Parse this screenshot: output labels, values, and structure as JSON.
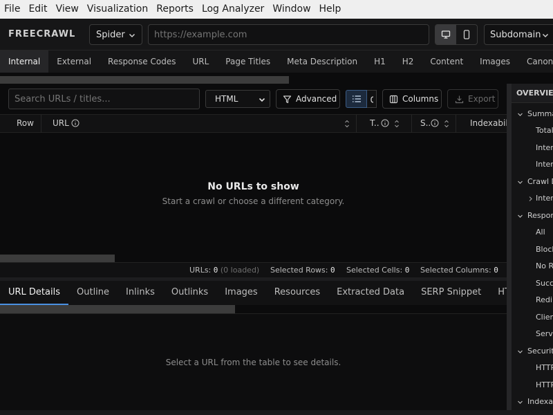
{
  "menu": [
    "File",
    "Edit",
    "View",
    "Visualization",
    "Reports",
    "Log Analyzer",
    "Window",
    "Help"
  ],
  "toolbar": {
    "brand": "FREECRAWL",
    "mode": "Spider",
    "url_placeholder": "https://example.com",
    "device_options": [
      "desktop",
      "mobile"
    ],
    "device_selected": "desktop",
    "scope": "Subdomain"
  },
  "category_tabs": [
    "Internal",
    "External",
    "Response Codes",
    "URL",
    "Page Titles",
    "Meta Description",
    "H1",
    "H2",
    "Content",
    "Images",
    "Canonicals"
  ],
  "category_active": "Internal",
  "filters": {
    "search_placeholder": "Search URLs / titles...",
    "type_select": "HTML",
    "advanced_label": "Advanced",
    "columns_label": "Columns",
    "export_label": "Export"
  },
  "table": {
    "columns": {
      "row": "Row",
      "url": "URL",
      "title": "T..",
      "status": "S..",
      "indexability": "Indexabili"
    },
    "empty_title": "No URLs to show",
    "empty_subtitle": "Start a crawl or choose a different category."
  },
  "status": {
    "urls_label": "URLs:",
    "urls_value": "0",
    "urls_loaded": "(0 loaded)",
    "rows_label": "Selected Rows:",
    "rows_value": "0",
    "cells_label": "Selected Cells:",
    "cells_value": "0",
    "cols_label": "Selected Columns:",
    "cols_value": "0"
  },
  "detail_tabs": [
    "URL Details",
    "Outline",
    "Inlinks",
    "Outlinks",
    "Images",
    "Resources",
    "Extracted Data",
    "SERP Snippet",
    "HTTP Hea"
  ],
  "detail_active": "URL Details",
  "detail_message": "Select a URL from the table to see details.",
  "overview": {
    "title": "OVERVIEW",
    "items": [
      {
        "label": "Summa",
        "level": 0,
        "state": "expanded"
      },
      {
        "label": "Total",
        "level": 1,
        "state": "leaf"
      },
      {
        "label": "Inter",
        "level": 1,
        "state": "leaf"
      },
      {
        "label": "Inter",
        "level": 1,
        "state": "leaf"
      },
      {
        "label": "Crawl D",
        "level": 0,
        "state": "expanded"
      },
      {
        "label": "Inter",
        "level": 1,
        "state": "collapsed"
      },
      {
        "label": "Respon",
        "level": 0,
        "state": "expanded"
      },
      {
        "label": "All",
        "level": 1,
        "state": "leaf"
      },
      {
        "label": "Block",
        "level": 1,
        "state": "leaf"
      },
      {
        "label": "No R",
        "level": 1,
        "state": "leaf"
      },
      {
        "label": "Succe",
        "level": 1,
        "state": "leaf"
      },
      {
        "label": "Redi",
        "level": 1,
        "state": "leaf"
      },
      {
        "label": "Client",
        "level": 1,
        "state": "leaf"
      },
      {
        "label": "Serv",
        "level": 1,
        "state": "leaf"
      },
      {
        "label": "Securit",
        "level": 0,
        "state": "expanded"
      },
      {
        "label": "HTTP",
        "level": 1,
        "state": "leaf"
      },
      {
        "label": "HTTP",
        "level": 1,
        "state": "leaf"
      },
      {
        "label": "Indexa",
        "level": 0,
        "state": "expanded"
      }
    ]
  },
  "colors": {
    "accent": "#4a90e2",
    "background": "#0b0b0c",
    "panel": "#161617",
    "menubar": "#efefef"
  }
}
